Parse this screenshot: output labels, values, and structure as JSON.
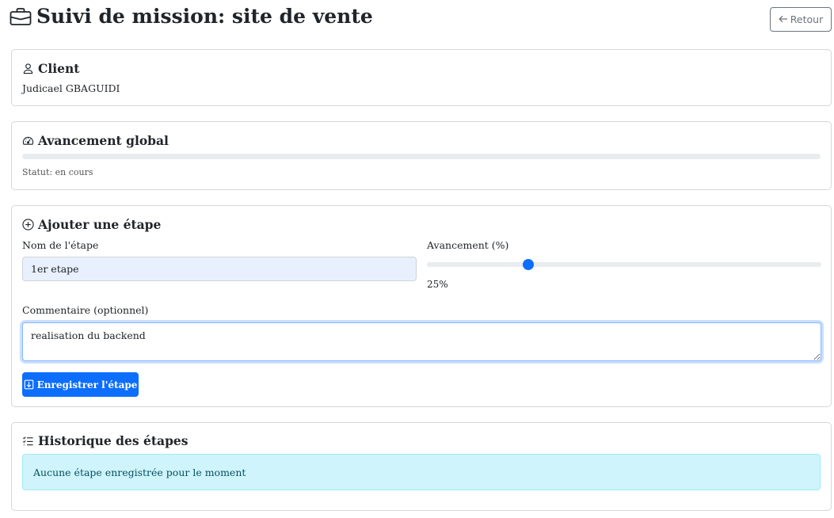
{
  "header": {
    "title": "Suivi de mission: site de vente",
    "title_icon": "briefcase-icon",
    "back_label": "Retour",
    "back_icon": "arrow-left-icon"
  },
  "client": {
    "title": "Client",
    "icon": "person-icon",
    "name": "Judicael GBAGUIDI"
  },
  "progress": {
    "title": "Avancement global",
    "icon": "speedometer-icon",
    "value_percent": 0,
    "status_text": "Statut: en cours"
  },
  "add_step": {
    "title": "Ajouter une étape",
    "icon": "plus-circle-icon",
    "name_label": "Nom de l'étape",
    "name_value": "1er etape",
    "progress_label": "Avancement (%)",
    "progress_value": 25,
    "progress_display": "25%",
    "comment_label": "Commentaire (optionnel)",
    "comment_value": "realisation du backend",
    "save_label": "Enregistrer l'étape",
    "save_icon": "download-icon"
  },
  "history": {
    "title": "Historique des étapes",
    "icon": "list-check-icon",
    "empty_text": "Aucune étape enregistrée pour le moment"
  },
  "colors": {
    "primary": "#0d6efd",
    "secondary": "#6c757d",
    "info_bg": "#cff4fc",
    "info_text": "#055160"
  }
}
